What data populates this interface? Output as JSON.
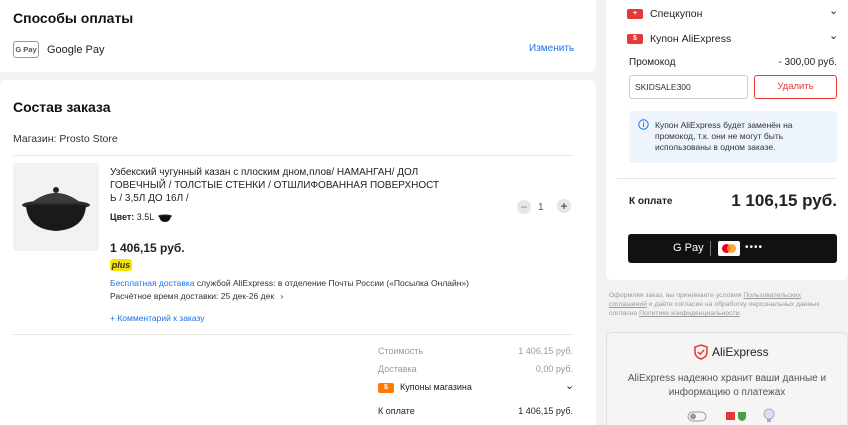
{
  "payment": {
    "title": "Способы оплаты",
    "method_badge": "G Pay",
    "method_name": "Google Pay",
    "change_link": "Изменить"
  },
  "order": {
    "title": "Состав заказа",
    "store_label": "Магазин: Prosto Store",
    "product": {
      "title_line1": "Узбекский чугунный казан с плоским дном,плов/ НАМАНГАН/ ДОЛ",
      "title_line2": "ГОВЕЧНЫЙ / ТОЛСТЫЕ СТЕНКИ / ОТШЛИФОВАННАЯ ПОВЕРХНОСТ",
      "title_line3": "Ь / 3,5Л ДО 16Л /",
      "color_label": "Цвет:",
      "color_value": "3.5L",
      "quantity": "1",
      "price": "1 406,15 руб.",
      "plus_badge": "plus",
      "shipping_free": "Бесплатная доставка",
      "shipping_rest": " службой AliExpress: в отделение Почты России («Посылка Онлайн»)",
      "delivery_estimate": "Расчётное время доставки: 25 дек-26 дек",
      "comment_link": "+ Комментарий к заказу"
    },
    "totals": {
      "cost_label": "Стоимость",
      "cost_value": "1 406,15 руб.",
      "shipping_label": "Доставка",
      "shipping_value": "0,00 руб.",
      "store_coupons_label": "Купоны магазина",
      "to_pay_label": "К оплате",
      "to_pay_value": "1 406,15 руб."
    }
  },
  "summary": {
    "special_coupon": "Спецкупон",
    "ae_coupon": "Купон AliExpress",
    "promo_label": "Промокод",
    "promo_discount": "- 300,00 руб.",
    "promo_code": "SKIDSALE300",
    "remove_button": "Удалить",
    "info_line1": "Купон AliExpress будет заменён на",
    "info_line2": "промокод, т.к. они не могут быть",
    "info_line3": "использованы в одном заказе.",
    "to_pay_label": "К оплате",
    "to_pay_value": "1 106,15 руб.",
    "pay_button_gpay": "G Pay",
    "pay_button_dots": "••••"
  },
  "legal": {
    "line1_pre": "Оформляя заказ, вы принимаете условия ",
    "line1_link": "Пользовательских",
    "line2_link": "соглашений",
    "line2_post": " и даёте согласие на обработку персональных данных",
    "line3_pre": "согласно ",
    "line3_link": "Политике конфиденциальности",
    "line3_post": "."
  },
  "trust": {
    "brand": "AliExpress",
    "text_line1": "AliExpress надежно хранит ваши данные и",
    "text_line2": "информацию о платежах"
  },
  "colors": {
    "accent_red": "#e53935",
    "link_blue": "#1a73e8",
    "plus_yellow": "#f5e400",
    "coupon_orange": "#ff7a00"
  }
}
